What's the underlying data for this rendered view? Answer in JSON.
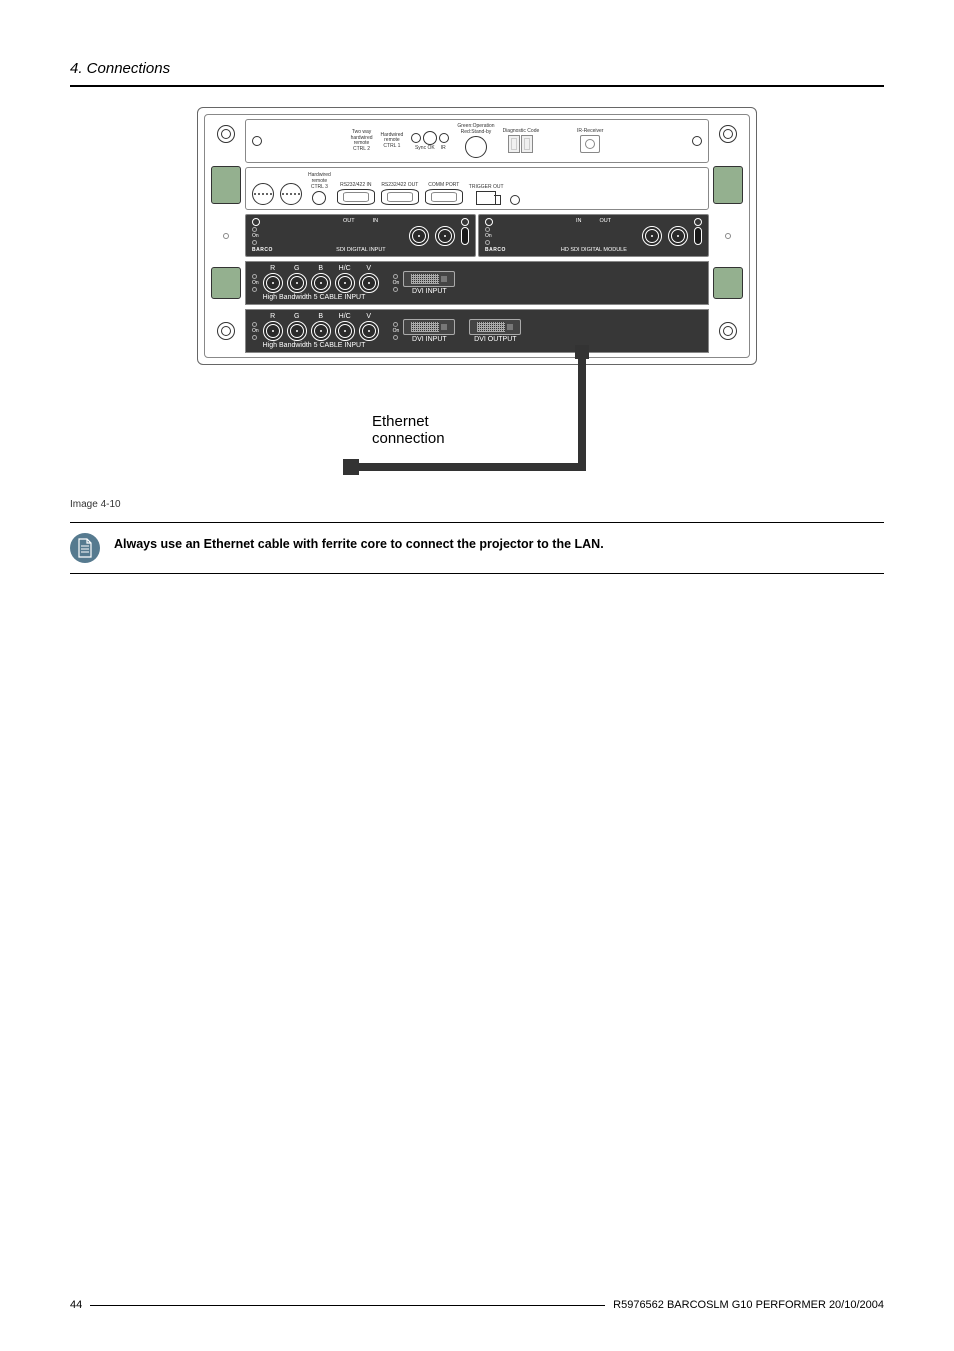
{
  "section": {
    "title": "4. Connections"
  },
  "diagram": {
    "caption": "Image 4-10",
    "top_strip": {
      "ctrl2": "Two way\nhardwired\nremote\nCTRL 2",
      "ctrl1_hard": "Hardwired\nremote\nCTRL 1",
      "sync": "Sync OK",
      "ir": "IR",
      "status": "Green:Operation\nRed:Stand-by",
      "diag": "Diagnostic Code",
      "ir_recv": "IR-Receiver"
    },
    "port_strip": {
      "ctrl3": "Hardwired\nremote\nCTRL 3",
      "rs_in": "RS232/422 IN",
      "rs_out": "RS232/422 OUT",
      "comm": "COMM PORT",
      "trigger": "TRIGGER OUT"
    },
    "module1": {
      "out": "OUT",
      "in": "IN",
      "brand": "BARCO",
      "name": "SDI DIGITAL INPUT"
    },
    "module2": {
      "in": "IN",
      "out": "OUT",
      "brand": "BARCO",
      "name": "HD SDI DIGITAL MODULE"
    },
    "cable_input": {
      "on": "On",
      "r": "R",
      "g": "G",
      "b": "B",
      "hc": "H/C",
      "v": "V",
      "label": "High Bandwidth 5 CABLE INPUT",
      "dvi_in": "DVI INPUT",
      "dvi_out": "DVI OUTPUT"
    },
    "ethernet_label_1": "Ethernet",
    "ethernet_label_2": "connection"
  },
  "note": {
    "text": "Always use an Ethernet cable with ferrite core to connect the projector to the LAN."
  },
  "footer": {
    "page": "44",
    "doc": "R5976562   BARCOSLM G10 PERFORMER   20/10/2004"
  }
}
